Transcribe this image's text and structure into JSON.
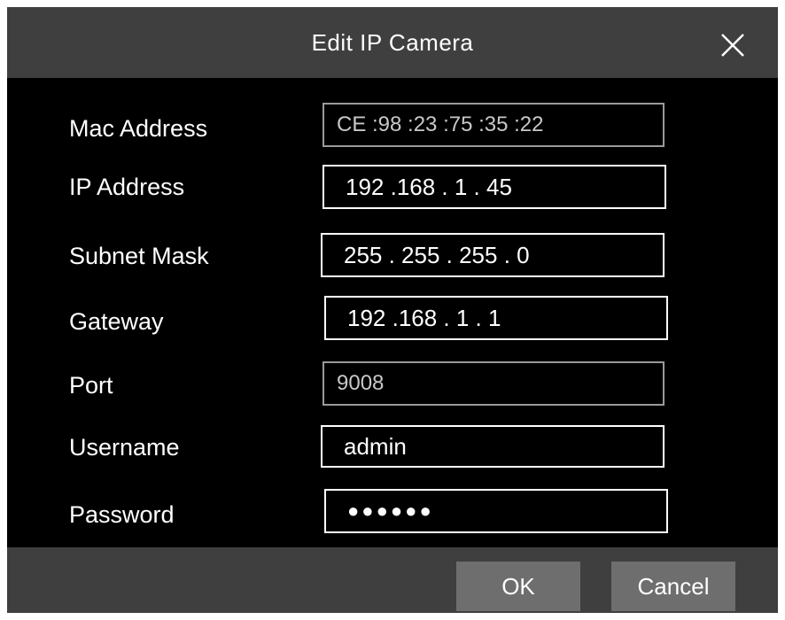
{
  "dialog": {
    "title": "Edit IP Camera",
    "close_icon": "close-icon"
  },
  "fields": {
    "mac": {
      "label": "Mac Address",
      "value": "CE :98 :23 :75 :35 :22"
    },
    "ip": {
      "label": "IP Address",
      "value": "192 .168 .  1   . 45"
    },
    "subnet": {
      "label": "Subnet Mask",
      "value": "255 . 255 . 255 .  0"
    },
    "gateway": {
      "label": "Gateway",
      "value": "192 .168 .  1   .   1"
    },
    "port": {
      "label": "Port",
      "value": "9008"
    },
    "username": {
      "label": "Username",
      "value": "admin"
    },
    "password": {
      "label": "Password",
      "value": "●●●●●●"
    }
  },
  "buttons": {
    "ok": "OK",
    "cancel": "Cancel"
  },
  "colors": {
    "titlebar": "#3f3f3f",
    "background": "#000000",
    "button": "#6e6e6e",
    "text": "#ffffff"
  }
}
